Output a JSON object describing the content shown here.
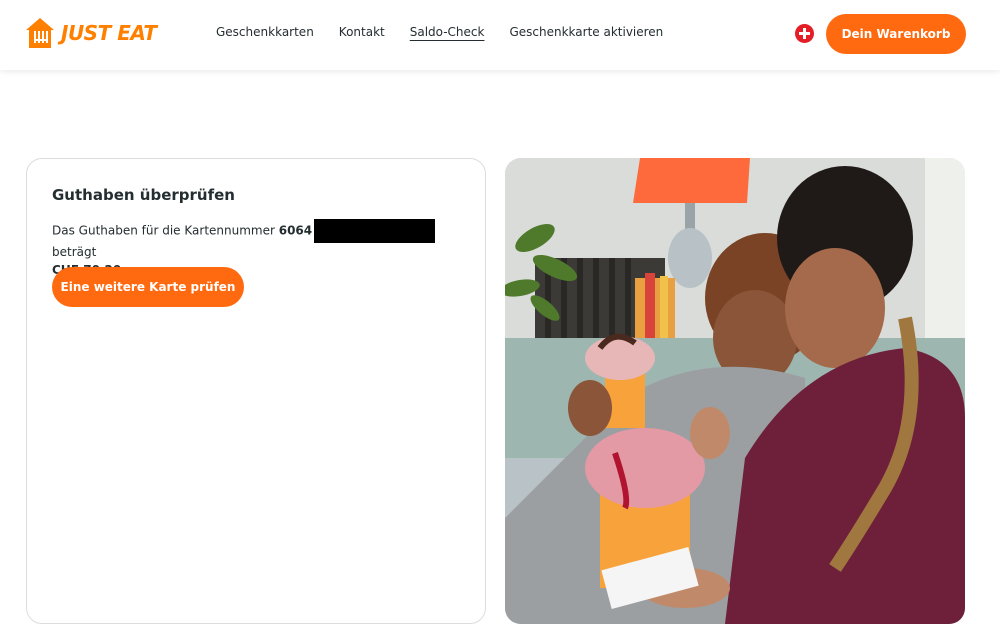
{
  "header": {
    "logo_text": "JUST EAT",
    "nav": [
      "Geschenkkarten",
      "Kontakt",
      "Saldo-Check",
      "Geschenkkarte aktivieren"
    ],
    "active_nav": "Saldo-Check",
    "country_icon": "swiss-flag-icon",
    "cart_label": "Dein Warenkorb"
  },
  "balance": {
    "title": "Guthaben überprüfen",
    "text_before": "Das Guthaben für die Kartennummer ",
    "card_number_prefix": "6064",
    "text_after": " beträgt",
    "amount": "CHF 70.20",
    "check_again_label": "Eine weitere Karte prüfen"
  },
  "colors": {
    "accent": "#ff6a10",
    "logo": "#ff8000",
    "text": "#242e30"
  }
}
